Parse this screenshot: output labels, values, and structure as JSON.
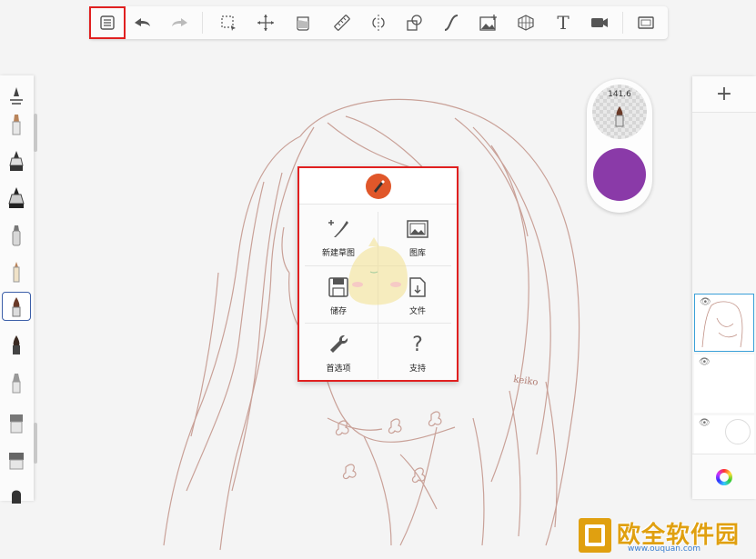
{
  "toolbar": {
    "tools": [
      {
        "name": "menu-list-icon"
      },
      {
        "name": "undo-icon"
      },
      {
        "name": "redo-icon"
      },
      {
        "name": "selection-icon"
      },
      {
        "name": "transform-icon"
      },
      {
        "name": "fill-bucket-icon"
      },
      {
        "name": "ruler-icon"
      },
      {
        "name": "symmetry-icon"
      },
      {
        "name": "shapes-icon"
      },
      {
        "name": "stroke-curve-icon"
      },
      {
        "name": "add-image-icon"
      },
      {
        "name": "perspective-grid-icon"
      },
      {
        "name": "text-icon"
      },
      {
        "name": "time-lapse-icon"
      },
      {
        "name": "fullscreen-icon"
      }
    ],
    "text_tool_glyph": "T"
  },
  "brush_puck": {
    "size_value": "141.6",
    "color": "#8a3aa8"
  },
  "layers": {
    "add_label": "+"
  },
  "main_menu": {
    "items": [
      {
        "label": "新建草图",
        "icon": "new-sketch-icon"
      },
      {
        "label": "图库",
        "icon": "gallery-icon"
      },
      {
        "label": "储存",
        "icon": "save-icon"
      },
      {
        "label": "文件",
        "icon": "file-icon"
      },
      {
        "label": "首选项",
        "icon": "wrench-icon"
      },
      {
        "label": "支持",
        "icon": "help-icon"
      }
    ],
    "help_glyph": "?"
  },
  "canvas": {
    "signature": "keiko"
  },
  "watermark": {
    "text": "欧全软件园",
    "url": "www.ouquan.com"
  },
  "colors": {
    "highlight": "#e02020",
    "sketch_line": "#b98478",
    "selected_brush_border": "#3c5fa8",
    "active_layer_border": "#3aa0d8"
  }
}
